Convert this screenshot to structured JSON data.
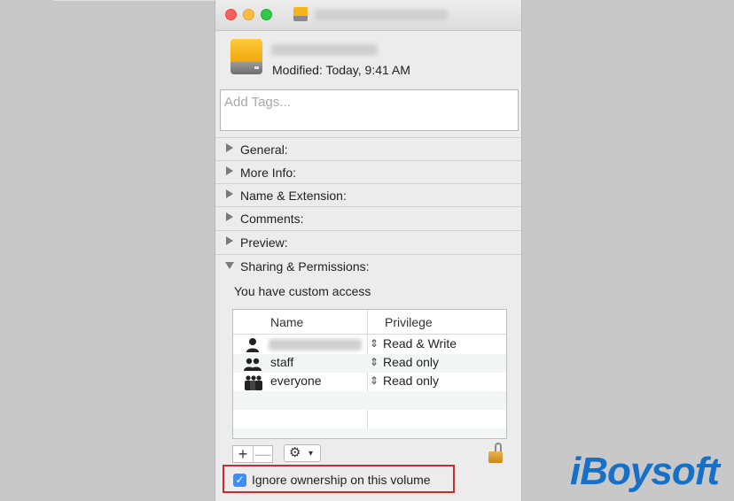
{
  "window": {
    "title_redacted": true,
    "icon": "hard-drive-icon"
  },
  "header": {
    "modified": "Modified: Today, 9:41 AM"
  },
  "tags": {
    "placeholder": "Add Tags..."
  },
  "sections": [
    {
      "label": "General:",
      "expanded": false
    },
    {
      "label": "More Info:",
      "expanded": false
    },
    {
      "label": "Name & Extension:",
      "expanded": false
    },
    {
      "label": "Comments:",
      "expanded": false
    },
    {
      "label": "Preview:",
      "expanded": false
    },
    {
      "label": "Sharing & Permissions:",
      "expanded": true
    }
  ],
  "permissions": {
    "access_text": "You have custom access",
    "columns": {
      "name": "Name",
      "privilege": "Privilege"
    },
    "rows": [
      {
        "name": "",
        "privilege": "Read & Write",
        "icon": "single-user-icon"
      },
      {
        "name": "staff",
        "privilege": "Read only",
        "icon": "group-icon"
      },
      {
        "name": "everyone",
        "privilege": "Read only",
        "icon": "everyone-icon"
      }
    ],
    "add_label": "+",
    "remove_label": "—",
    "stepper_glyph": "⌃⌄"
  },
  "ignore_ownership": {
    "label": "Ignore ownership on this volume",
    "checked": true
  },
  "watermark": {
    "text": "iBoysoft",
    "color": "#1670c8"
  },
  "colors": {
    "highlight_border": "#cc2b2b",
    "checkbox": "#3d8dfc"
  }
}
